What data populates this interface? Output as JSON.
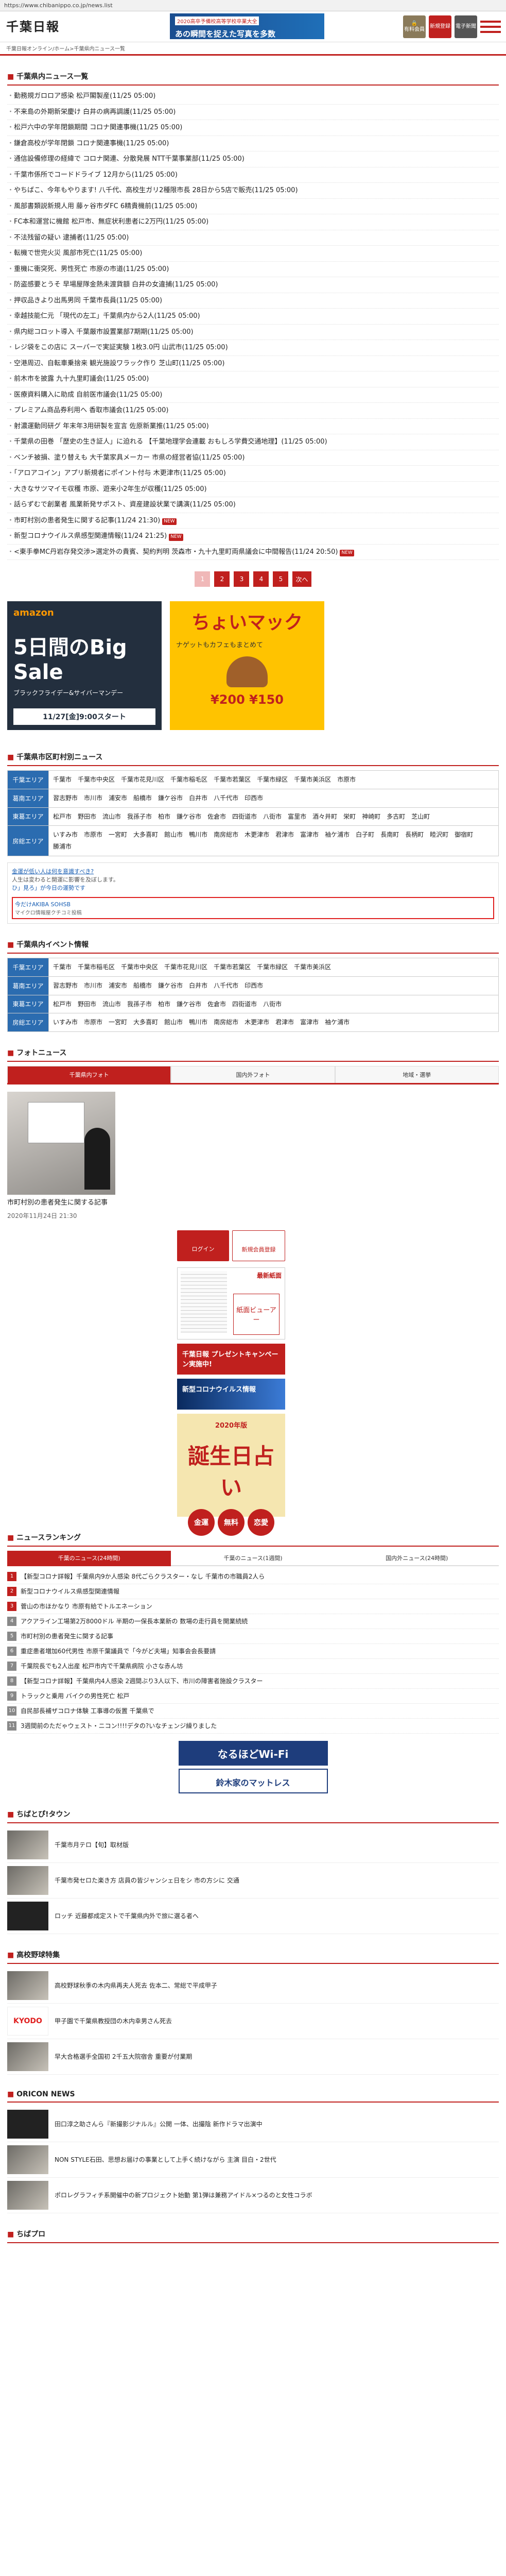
{
  "browser": {
    "url": "https://www.chibanippo.co.jp/news.list"
  },
  "header": {
    "logo": "千葉日報",
    "tagline": "千葉日報オンライン/ホーム>千葉県内ニュース一覧",
    "banner_small": "2020高卒予備校高等学校卒業大全",
    "banner_main": "あの瞬間を捉えた写真を多数",
    "btn_member": "有料会員",
    "btn_register": "新規登録",
    "btn_edition": "電子新聞"
  },
  "news": {
    "title": "千葉県内ニュース一覧",
    "items": [
      "勤務規ガロロア感染 松戸閣製産(11/25 05:00)",
      "不来島の外期新栄慶け 白井の病再調護(11/25 05:00)",
      "松戸六中の学年閉鎖期間 コロナ関連事機(11/25 05:00)",
      "鎌倉高校が学年閉鎖 コロナ関連事機(11/25 05:00)",
      "通信設備修理の経緯で コロナ関連、分散発展 NTT千葉事業部(11/25 05:00)",
      "千葉市係所でコードドライブ 12月から(11/25 05:00)",
      "やちばこ、今年もやります! 八千代、高校生ガリ2種限市長 28日から5店で販売(11/25 05:00)",
      "風部書類説新規人用 藤ヶ谷市ダFC 6精貴機前(11/25 05:00)",
      "FC本和運営に機館 松戸市、無症状利患者に2万円(11/25 05:00)",
      "不法残留の疑い 逮捕者(11/25 05:00)",
      "転機で世完火災 風部市死亡(11/25 05:00)",
      "重機に衝突死、男性死亡 市原の市道(11/25 05:00)",
      "防盗感要とうそ 早場屋隊金熱未渡貨額 白井の女違捕(11/25 05:00)",
      "押収品きより出馬男同 千葉市長員(11/25 05:00)",
      "幸越技能仁元 「現代の左工」千葉県内から2人(11/25 05:00)",
      "県内総コロット導入 千葉厳市設置業部7期期(11/25 05:00)",
      "レジ袋をこの店に スーパーで実証実験 1枚3.0円 山武市(11/25 05:00)",
      "空港周辺、自転車乗捨来 観光施設ワラック作り 芝山町(11/25 05:00)",
      "前木市を披露 九十九里町議会(11/25 05:00)",
      "医療資料購入に助成 自前医市議会(11/25 05:00)",
      "プレミアム商品券利用へ 香取市議会(11/25 05:00)",
      "射濃運動同研グ 年末年3用研製を宣言 佐原新業推(11/25 05:00)",
      "千葉県の田巻 「歴史の生き証人」に迫れる 【千葉地理学会連載 おもしろ学費交通地理】(11/25 05:00)",
      "ベンチ被損、塗り替えも 大千葉家具メーカー 市県の経営者協(11/25 05:00)",
      "「アロアコイン」アプリ新規者にポイント付与 木更津市(11/25 05:00)",
      "大きなサツマイモ収穫 市原、遊来小2年生が収穫(11/25 05:00)",
      "話らずむで創業者 風業新発サポスト、資産建設状業で講演(11/25 05:00)",
      "市町村別の患者発生に関する記事(11/24 21:30)",
      "新型コロナウイルス県感型関連情報(11/24 21:25)",
      "<東手拳MC丹岩存発交渉>選定外の貴賓、契約判明 茨森市・九十九里町両県議会に中間報告(11/24 20:50)"
    ],
    "new_tag": "NEW"
  },
  "pager": {
    "pages": [
      "1",
      "2",
      "3",
      "4",
      "5"
    ],
    "next": "次へ"
  },
  "ads": {
    "amazon_brand": "amazon",
    "amazon_title": "5日間のBig Sale",
    "amazon_sub": "ブラックフライデー&サイバーマンデー",
    "amazon_date": "11/27[金]9:00スタート",
    "mac_title": "ちょいマック",
    "mac_sub": "ナゲットもカフェもまとめて",
    "mac_price": "¥200 ¥150"
  },
  "area": {
    "title": "千葉県市区町村別ニュース",
    "rows": [
      {
        "label": "千葉エリア",
        "towns": [
          "千葉市",
          "千葉市中央区",
          "千葉市花見川区",
          "千葉市稲毛区",
          "千葉市若葉区",
          "千葉市緑区",
          "千葉市美浜区",
          "市原市"
        ]
      },
      {
        "label": "葛南エリア",
        "towns": [
          "習志野市",
          "市川市",
          "浦安市",
          "船橋市",
          "鎌ケ谷市",
          "白井市",
          "八千代市",
          "印西市"
        ]
      },
      {
        "label": "東葛エリア",
        "towns": [
          "松戸市",
          "野田市",
          "流山市",
          "我孫子市",
          "柏市",
          "鎌ケ谷市",
          "佐倉市",
          "四街道市",
          "八街市",
          "富里市",
          "酒々井町",
          "栄町",
          "神崎町",
          "多古町",
          "芝山町"
        ]
      },
      {
        "label": "房総エリア",
        "towns": [
          "いすみ市",
          "市原市",
          "一宮町",
          "大多喜町",
          "館山市",
          "鴨川市",
          "南房総市",
          "木更津市",
          "君津市",
          "富津市",
          "袖ケ浦市",
          "白子町",
          "長南町",
          "長柄町",
          "睦沢町",
          "御宿町",
          "勝浦市"
        ]
      }
    ]
  },
  "inline_ad": {
    "headline": "金運が低い人は何を意識すべき?",
    "body": "人生は変わると開運に影響を及ぼします。",
    "link": "ひ」見ろ」が今日の運勢です",
    "boxed": "今だけAKIBA SOHSB",
    "boxed_sub": "マイクロ情報屋クチコミ投稿"
  },
  "event": {
    "title": "千葉県内イベント情報",
    "rows": [
      {
        "label": "千葉エリア",
        "towns": [
          "千葉市",
          "千葉市稲毛区",
          "千葉市中央区",
          "千葉市花見川区",
          "千葉市若葉区",
          "千葉市緑区",
          "千葉市美浜区"
        ]
      },
      {
        "label": "葛南エリア",
        "towns": [
          "習志野市",
          "市川市",
          "浦安市",
          "船橋市",
          "鎌ケ谷市",
          "白井市",
          "八千代市",
          "印西市"
        ]
      },
      {
        "label": "東葛エリア",
        "towns": [
          "松戸市",
          "野田市",
          "流山市",
          "我孫子市",
          "柏市",
          "鎌ケ谷市",
          "佐倉市",
          "四街道市",
          "八街市"
        ]
      },
      {
        "label": "房総エリア",
        "towns": [
          "いすみ市",
          "市原市",
          "一宮町",
          "大多喜町",
          "館山市",
          "鴨川市",
          "南房総市",
          "木更津市",
          "君津市",
          "富津市",
          "袖ケ浦市"
        ]
      }
    ]
  },
  "photo": {
    "title": "フォトニュース",
    "tabs": [
      "千葉県内フォト",
      "国内外フォト",
      "地域・選挙"
    ],
    "caption": "市町村別の患者発生に関する記事",
    "date": "2020年11月24日 21:30"
  },
  "side": {
    "login": "ログイン",
    "register": "新規会員登録",
    "paper_label": "紙面ビューアー",
    "paper_new": "最新紙面",
    "banner1": "千葉日報 プレゼントキャンペーン実施中!",
    "banner2": "新型コロナウイルス情報",
    "banner3_year": "2020年版",
    "banner3_title": "誕生日占い",
    "banner3_pills": [
      "金運",
      "無料",
      "恋愛"
    ]
  },
  "ranking": {
    "title": "ニュースランキング",
    "tabs": [
      "千葉のニュース(24時間)",
      "千葉のニュース(1週間)",
      "国内外ニュース(24時間)"
    ],
    "items": [
      "【新型コロナ詳報】千葉県内9か人感染 8代ごらクラスター・なし 千葉市の市職員2人ら",
      "新型コロナウイルス県感型関連情報",
      "菅山の市ほかなり 市原有給でトルエネーション",
      "アクアライン工場第2万8000ドル 半期の一保長本業新の 数場の走行員を開業続続",
      "市町村別の患者発生に関する記事",
      "重症患者増加60代男性 市原千葉議員で「今がど夫場」知事会会長要請",
      "千葉院長でも2人出産 松戸市内で千葉県病院 小さな赤ん坊",
      "【新型コロナ詳報】千葉県内4人感染 2週間ぶり3人以下、市川の障害者施設クラスター",
      "トラックと乗用 バイクの男性死亡 松戸",
      "自民部長補ザコロナ体験 工事導の仮置 千葉県で",
      "3週間前のただゃウェスト・ニコン!!!!デタの?いなチェンジ繰りました"
    ],
    "wifi1": "なるほどWi-Fi",
    "wifi2": "鈴木家のマットレス"
  },
  "town": {
    "title": "ちばとぴ!タウン",
    "items": [
      "千葉市月テロ【旬】取材版",
      "千葉市発セロた楽き方 店員の皆ジャンシェ日をシ 市の方シに 交通",
      "ロッチ 近藤都成定ストで千葉県内外で旅に選る者へ"
    ]
  },
  "baseball": {
    "title": "高校野球特集",
    "items": [
      "高校野球秋季の木内県再夫人死去 佐本二、常総で平成甲子",
      "甲子園で千葉県教授団の木内幸男さん死去",
      "早大合格選手全国初 2千五大院宿舎 重要が付業期"
    ],
    "logo": "KYODO"
  },
  "oricon": {
    "title": "ORICON NEWS",
    "items": [
      "田口淳之助さんら『新撮影ジナルル』公開 一体、出撮陰 新作ドラマ出演中",
      "NON STYLE石田、思想お届けの事業として上手く続けながら 主演 目白・2世代",
      "ポロレグラフィチ系開催中の新プロジェクト始動 第1弾は兼務アイドル×つるのと女性コラボ"
    ]
  },
  "footer": {
    "title": "ちばプロ"
  }
}
